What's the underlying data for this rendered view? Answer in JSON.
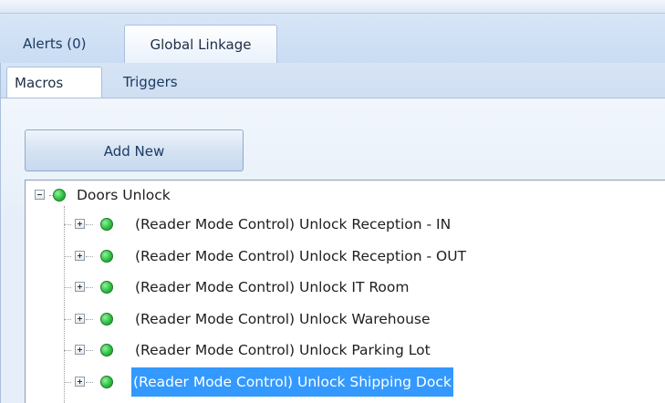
{
  "outer_tabs": [
    {
      "label": "Alerts (0)"
    },
    {
      "label": "Global Linkage"
    }
  ],
  "inner_tabs": [
    {
      "label": "Macros"
    },
    {
      "label": "Triggers"
    }
  ],
  "add_button": {
    "label": "Add New"
  },
  "tree": {
    "root": {
      "label": "Doors Unlock",
      "status": "active",
      "expanded": true
    },
    "children": [
      {
        "label": "(Reader Mode Control) Unlock Reception - IN",
        "selected": false
      },
      {
        "label": "(Reader Mode Control) Unlock Reception - OUT",
        "selected": false
      },
      {
        "label": "(Reader Mode Control) Unlock IT Room",
        "selected": false
      },
      {
        "label": "(Reader Mode Control) Unlock Warehouse",
        "selected": false
      },
      {
        "label": "(Reader Mode Control) Unlock Parking Lot",
        "selected": false
      },
      {
        "label": "(Reader Mode Control) Unlock Shipping Dock",
        "selected": true
      }
    ]
  },
  "colors": {
    "status_dot": "#2fbf44",
    "selection": "#3399ff",
    "panel_bg": "#dde9f6"
  },
  "icons": {
    "status": "green-status-dot-icon",
    "collapse": "minus-box-icon",
    "expand": "plus-box-icon"
  }
}
